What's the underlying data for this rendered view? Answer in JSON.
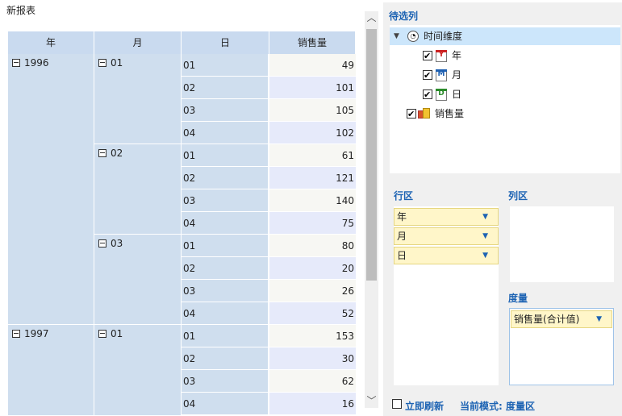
{
  "report": {
    "title": "新报表"
  },
  "table": {
    "headers": [
      "年",
      "月",
      "日",
      "销售量"
    ],
    "rows": [
      {
        "year": "1996",
        "month": "01",
        "day": "01",
        "value": "49"
      },
      {
        "year": "",
        "month": "",
        "day": "02",
        "value": "101"
      },
      {
        "year": "",
        "month": "",
        "day": "03",
        "value": "105"
      },
      {
        "year": "",
        "month": "",
        "day": "04",
        "value": "102"
      },
      {
        "year": "",
        "month": "02",
        "day": "01",
        "value": "61"
      },
      {
        "year": "",
        "month": "",
        "day": "02",
        "value": "121"
      },
      {
        "year": "",
        "month": "",
        "day": "03",
        "value": "140"
      },
      {
        "year": "",
        "month": "",
        "day": "04",
        "value": "75"
      },
      {
        "year": "",
        "month": "03",
        "day": "01",
        "value": "80"
      },
      {
        "year": "",
        "month": "",
        "day": "02",
        "value": "20"
      },
      {
        "year": "",
        "month": "",
        "day": "03",
        "value": "26"
      },
      {
        "year": "",
        "month": "",
        "day": "04",
        "value": "52"
      },
      {
        "year": "1997",
        "month": "01",
        "day": "01",
        "value": "153"
      },
      {
        "year": "",
        "month": "",
        "day": "02",
        "value": "30"
      },
      {
        "year": "",
        "month": "",
        "day": "03",
        "value": "62"
      },
      {
        "year": "",
        "month": "",
        "day": "04",
        "value": "16"
      }
    ]
  },
  "panel": {
    "candidates_title": "待选列",
    "tree": {
      "root": "时间维度",
      "children": [
        "年",
        "月",
        "日"
      ],
      "measure": "销售量"
    },
    "row_zone_title": "行区",
    "row_items": [
      "年",
      "月",
      "日"
    ],
    "col_zone_title": "列区",
    "measure_zone_title": "度量",
    "measure_items": [
      "销售量(合计值)"
    ],
    "refresh_label": "立即刷新",
    "mode_label": "当前模式: 度量区"
  },
  "icons": {
    "collapse": "minus-square-icon",
    "expand_tree": "chevron-down-icon",
    "time_dimension": "clock-icon",
    "year": "calendar-year-icon",
    "month": "calendar-month-icon",
    "day": "calendar-day-icon",
    "measure": "measure-bar-icon",
    "dropdown": "dropdown-arrow-icon"
  },
  "colors": {
    "header_bg": "#c9daef",
    "dim_bg": "#cfdeee",
    "value_alt": "#e6eafa",
    "accent": "#1d63b3",
    "drop_item_bg": "#fff6c9"
  }
}
